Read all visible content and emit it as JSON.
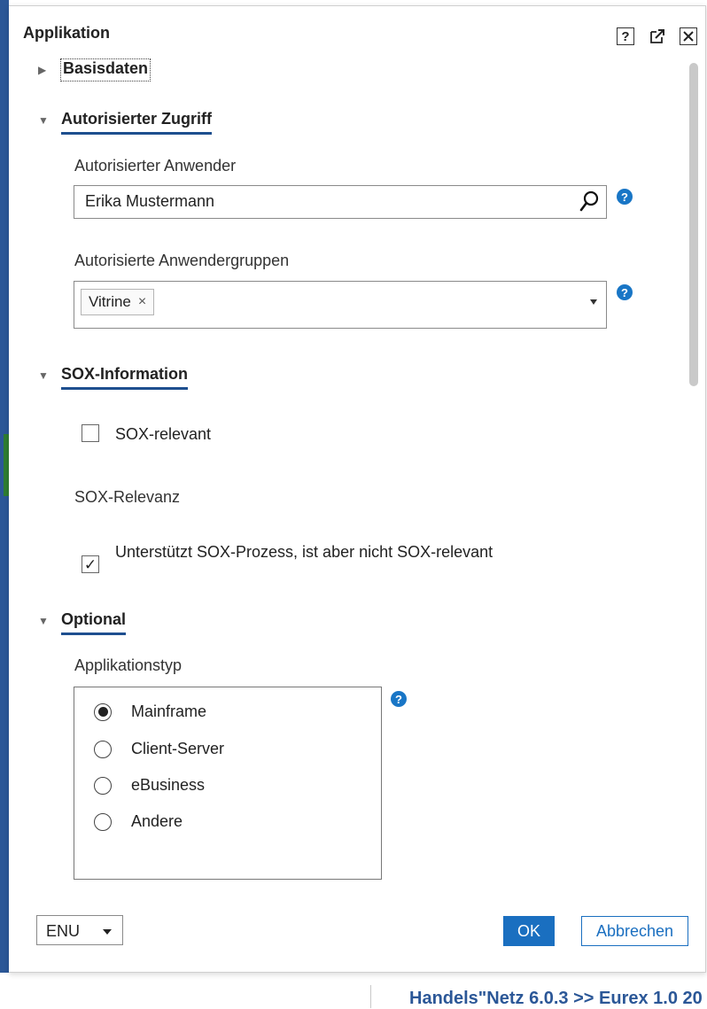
{
  "dialog": {
    "title": "Applikation",
    "help_glyph": "?",
    "popout_glyph": "↗",
    "close_glyph": "✕"
  },
  "sections": {
    "basisdaten": {
      "title": "Basisdaten",
      "expanded": false
    },
    "autorisierter_zugriff": {
      "title": "Autorisierter Zugriff",
      "expanded": true,
      "user_label": "Autorisierter Anwender",
      "user_value": "Erika Mustermann",
      "groups_label": "Autorisierte Anwendergruppen",
      "groups_chips": [
        "Vitrine"
      ],
      "chip_remove_glyph": "×"
    },
    "sox": {
      "title": "SOX-Information",
      "expanded": true,
      "sox_relevant_label": "SOX-relevant",
      "sox_relevant_checked": false,
      "sox_relevanz_label": "SOX-Relevanz",
      "supports_label": "Unterstützt SOX-Prozess, ist aber nicht SOX-relevant",
      "supports_checked": true,
      "check_glyph": "✓"
    },
    "optional": {
      "title": "Optional",
      "expanded": true,
      "apptype_label": "Applikationstyp",
      "apptype_options": [
        "Mainframe",
        "Client-Server",
        "eBusiness",
        "Andere"
      ],
      "apptype_selected": "Mainframe"
    }
  },
  "help_icon_glyph": "?",
  "footer": {
    "language_value": "ENU",
    "ok_label": "OK",
    "cancel_label": "Abbrechen"
  },
  "background": {
    "bottom_text": "Handels\"Netz 6.0.3 >> Eurex 1.0 20"
  },
  "colors": {
    "accent": "#1a6fc0",
    "section_underline": "#1e4f8f",
    "help_icon": "#1976c6",
    "left_strip": "#2b5797"
  }
}
